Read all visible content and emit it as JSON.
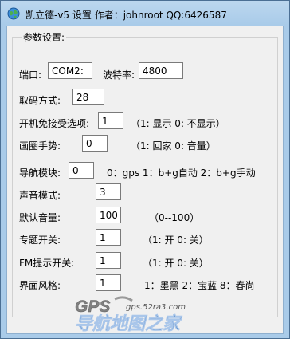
{
  "window": {
    "title": "凯立德-v5 设置  作者：johnroot  QQ:6426587"
  },
  "group": {
    "title": "参数设置:"
  },
  "fields": {
    "port": {
      "label": "端口:",
      "value": "COM2:"
    },
    "baud": {
      "label": "波特率:",
      "value": "4800"
    },
    "code_mode": {
      "label": "取码方式:",
      "value": "28"
    },
    "boot_skip": {
      "label": "开机免接受选项:",
      "value": "1",
      "hint": "（1: 显示 0: 不显示）"
    },
    "circle_gesture": {
      "label": "画圈手势:",
      "value": "0",
      "hint": "（1: 回家 0: 音量）"
    },
    "nav_module": {
      "label": "导航模块:",
      "value": "0",
      "hint": "0：gps 1：b+g自动 2：b+g手动"
    },
    "sound_mode": {
      "label": "声音模式:",
      "value": "3"
    },
    "default_volume": {
      "label": "默认音量:",
      "value": "100",
      "hint": "（0--100）"
    },
    "topic_switch": {
      "label": "专题开关:",
      "value": "1",
      "hint": "（1: 开 0: 关）"
    },
    "fm_prompt": {
      "label": "FM提示开关:",
      "value": "1",
      "hint": "（1: 开 0: 关）"
    },
    "ui_style": {
      "label": "界面风格:",
      "value": "1",
      "hint": "1：墨黑 2：宝蓝 8：春尚"
    }
  },
  "logo": {
    "brand": "GPS",
    "site": "gps.52ra3.com",
    "slogan": "导航地图之家"
  },
  "colors": {
    "logo_text": "#3a73b8",
    "titlebar": "#a9cbe9"
  }
}
